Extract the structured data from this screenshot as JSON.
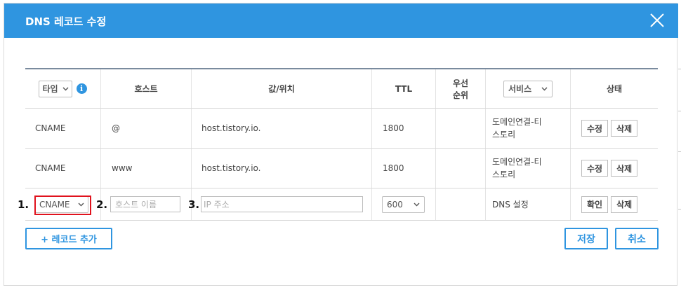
{
  "dialog": {
    "title": "DNS 레코드 수정",
    "close_icon": "close-icon"
  },
  "table": {
    "headers": {
      "type_select": "타입",
      "host": "호스트",
      "value": "값/위치",
      "ttl": "TTL",
      "priority_line1": "우선",
      "priority_line2": "순위",
      "service_select": "서비스",
      "status": "상태"
    },
    "rows": [
      {
        "type": "CNAME",
        "host": "@",
        "value": "host.tistory.io.",
        "ttl": "1800",
        "priority": "",
        "service_line1": "도메인연결-티",
        "service_line2": "스토리",
        "edit_label": "수정",
        "delete_label": "삭제"
      },
      {
        "type": "CNAME",
        "host": "www",
        "value": "host.tistory.io.",
        "ttl": "1800",
        "priority": "",
        "service_line1": "도메인연결-티",
        "service_line2": "스토리",
        "edit_label": "수정",
        "delete_label": "삭제"
      }
    ],
    "edit_row": {
      "type_value": "CNAME",
      "host_placeholder": "호스트 이름",
      "ip_placeholder": "IP 주소",
      "ttl_value": "600",
      "service": "DNS 설정",
      "confirm_label": "확인",
      "delete_label": "삭제",
      "step_1": "1.",
      "step_2": "2.",
      "step_3": "3."
    }
  },
  "footer": {
    "add_record": "+ 레코드 추가",
    "save": "저장",
    "cancel": "취소"
  },
  "colors": {
    "header_bg": "#2f95e0",
    "accent": "#2f95e0",
    "highlight": "#e0121d"
  }
}
